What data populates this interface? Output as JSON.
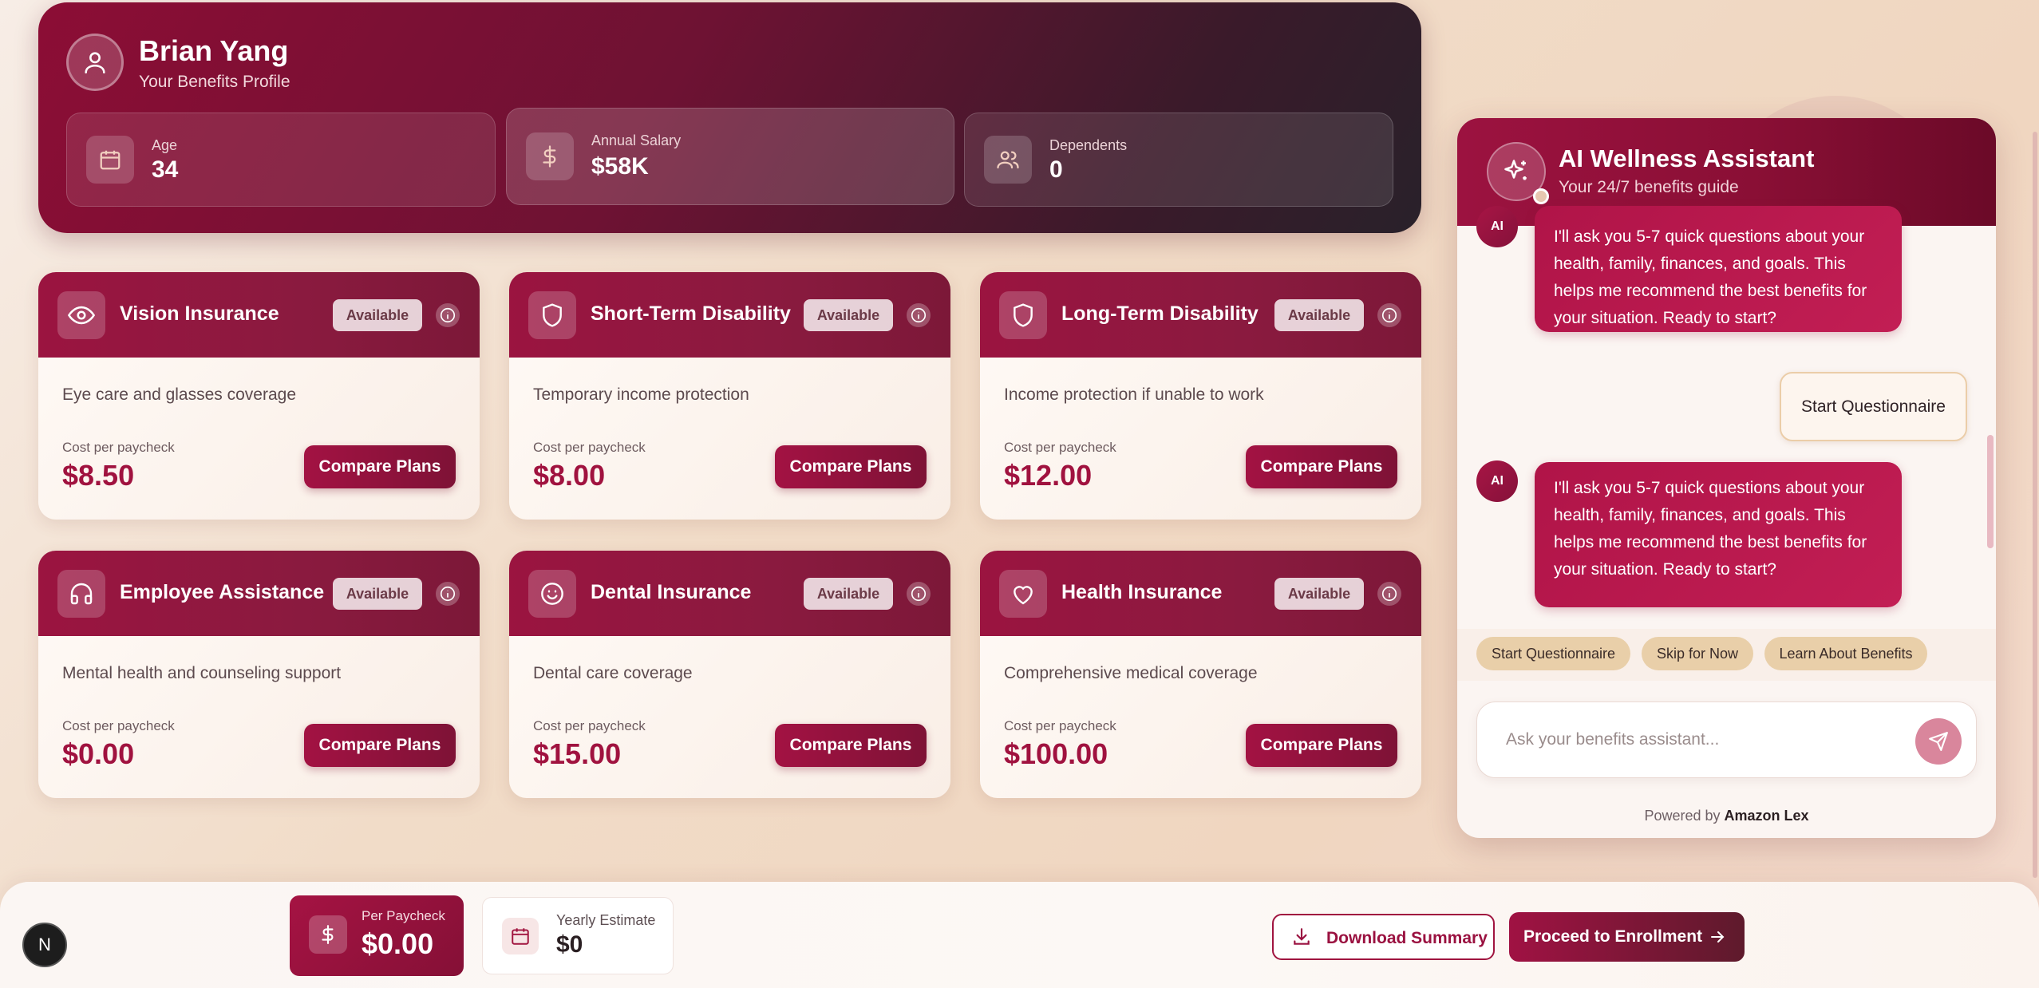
{
  "profile": {
    "name": "Brian Yang",
    "subtitle": "Your Benefits Profile",
    "stats": [
      {
        "label": "Age",
        "value": "34",
        "icon": "calendar-icon"
      },
      {
        "label": "Annual Salary",
        "value": "$58K",
        "icon": "dollar-icon"
      },
      {
        "label": "Dependents",
        "value": "0",
        "icon": "users-icon"
      }
    ]
  },
  "cards": [
    {
      "title": "Vision Insurance",
      "badge": "Available",
      "description": "Eye care and glasses coverage",
      "cost_label": "Cost per paycheck",
      "price": "$8.50",
      "button": "Compare Plans",
      "icon": "eye-icon"
    },
    {
      "title": "Short-Term Disability",
      "badge": "Available",
      "description": "Temporary income protection",
      "cost_label": "Cost per paycheck",
      "price": "$8.00",
      "button": "Compare Plans",
      "icon": "shield-icon"
    },
    {
      "title": "Long-Term Disability",
      "badge": "Available",
      "description": "Income protection if unable to work",
      "cost_label": "Cost per paycheck",
      "price": "$12.00",
      "button": "Compare Plans",
      "icon": "shield-icon"
    },
    {
      "title": "Employee Assistance",
      "badge": "Available",
      "description": "Mental health and counseling support",
      "cost_label": "Cost per paycheck",
      "price": "$0.00",
      "button": "Compare Plans",
      "icon": "headphones-icon"
    },
    {
      "title": "Dental Insurance",
      "badge": "Available",
      "description": "Dental care coverage",
      "cost_label": "Cost per paycheck",
      "price": "$15.00",
      "button": "Compare Plans",
      "icon": "smile-icon"
    },
    {
      "title": "Health Insurance",
      "badge": "Available",
      "description": "Comprehensive medical coverage",
      "cost_label": "Cost per paycheck",
      "price": "$100.00",
      "button": "Compare Plans",
      "icon": "heart-icon"
    }
  ],
  "chat": {
    "title": "AI Wellness Assistant",
    "subtitle": "Your 24/7 benefits guide",
    "ai_label": "AI",
    "messages": [
      {
        "from": "ai",
        "text": "I'll ask you 5-7 quick questions about your health, family, finances, and goals. This helps me recommend the best benefits for your situation. Ready to start?"
      },
      {
        "from": "user",
        "text": "Start Questionnaire"
      },
      {
        "from": "ai",
        "text": "I'll ask you 5-7 quick questions about your health, family, finances, and goals. This helps me recommend the best benefits for your situation. Ready to start?"
      }
    ],
    "quick_replies": [
      "Start Questionnaire",
      "Skip for Now",
      "Learn About Benefits"
    ],
    "input_placeholder": "Ask your benefits assistant...",
    "powered_prefix": "Powered by",
    "powered_brand": "Amazon Lex"
  },
  "footer": {
    "per_paycheck_label": "Per Paycheck",
    "per_paycheck_value": "$0.00",
    "yearly_label": "Yearly Estimate",
    "yearly_value": "$0",
    "download_label": "Download Summary",
    "enroll_label": "Proceed to Enrollment",
    "dev_badge": "N"
  },
  "colors": {
    "brand": "#9c1240",
    "brand_dark": "#6b0a28",
    "accent_chip": "#e9cfa9"
  }
}
